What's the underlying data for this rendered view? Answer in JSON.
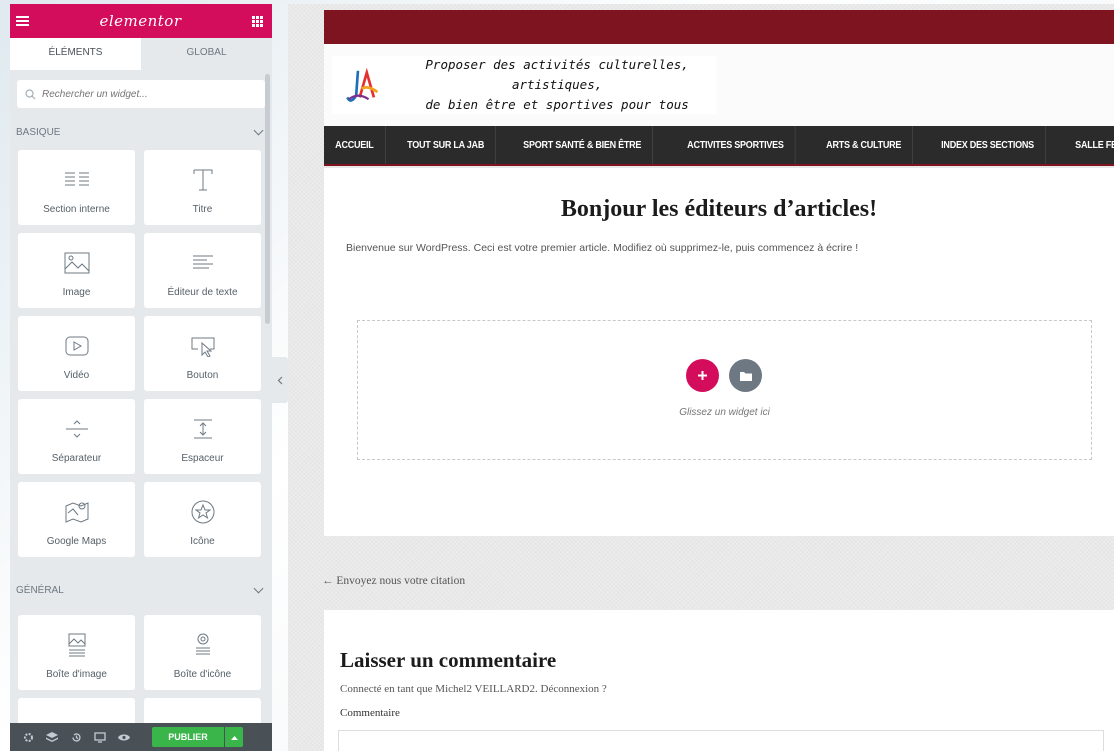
{
  "panel": {
    "logo": "elementor",
    "tabs": [
      {
        "label": "ÉLÉMENTS",
        "active": true
      },
      {
        "label": "GLOBAL",
        "active": false
      }
    ],
    "search_placeholder": "Rechercher un widget...",
    "categories": [
      {
        "title": "BASIQUE",
        "widgets": [
          {
            "label": "Section interne",
            "icon": "columns-icon"
          },
          {
            "label": "Titre",
            "icon": "heading-icon"
          },
          {
            "label": "Image",
            "icon": "image-icon"
          },
          {
            "label": "Éditeur de texte",
            "icon": "text-editor-icon"
          },
          {
            "label": "Vidéo",
            "icon": "video-icon"
          },
          {
            "label": "Bouton",
            "icon": "button-icon"
          },
          {
            "label": "Séparateur",
            "icon": "divider-icon"
          },
          {
            "label": "Espaceur",
            "icon": "spacer-icon"
          },
          {
            "label": "Google Maps",
            "icon": "map-icon"
          },
          {
            "label": "Icône",
            "icon": "star-icon"
          }
        ]
      },
      {
        "title": "GÉNÉRAL",
        "widgets": [
          {
            "label": "Boîte d'image",
            "icon": "image-box-icon"
          },
          {
            "label": "Boîte d'icône",
            "icon": "icon-box-icon"
          }
        ]
      }
    ],
    "footer": {
      "publish_label": "PUBLIER"
    },
    "colors": {
      "brand": "#d30c5c",
      "publish": "#39b54a",
      "footer": "#495157"
    }
  },
  "site": {
    "tagline_line1": "Proposer des activités culturelles, artistiques,",
    "tagline_line2": "de bien être et sportives pour tous",
    "nav": [
      "ACCUEIL",
      "TOUT SUR LA JAB",
      "SPORT SANTÉ & BIEN ÊTRE",
      "ACTIVITES SPORTIVES",
      "ARTS & CULTURE",
      "INDEX DES SECTIONS",
      "SALLE FESTIVE"
    ],
    "colors": {
      "topbar": "#7d1420",
      "nav": "#2b2b2b"
    }
  },
  "article": {
    "title": "Bonjour les éditeurs d’articles!",
    "body": "Bienvenue sur WordPress. Ceci est votre premier article. Modifiez où supprimez-le, puis commencez à écrire !",
    "dropzone_text": "Glissez un widget ici"
  },
  "prev_link": "← Envoyez nous votre citation",
  "comments": {
    "title": "Laisser un commentaire",
    "logged_in": "Connecté en tant que Michel2 VEILLARD2. Déconnexion ?",
    "comment_label": "Commentaire"
  }
}
